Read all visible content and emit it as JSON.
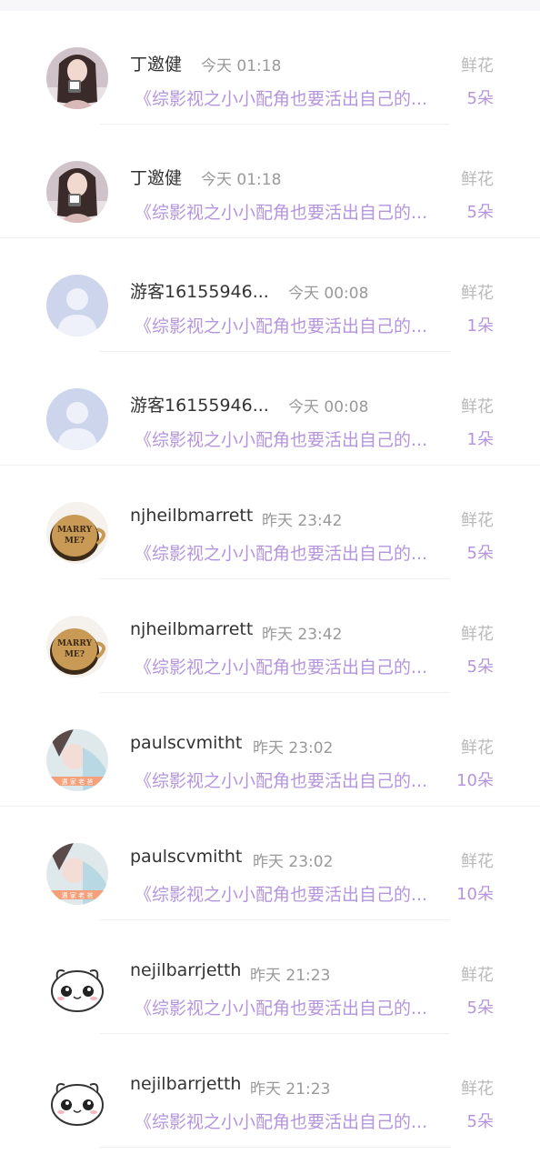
{
  "records": [
    {
      "name": "丁邀健",
      "time": "今天 01:18",
      "gift": "鲜花",
      "book": "《综影视之小小配角也要活出自己的...",
      "count": "5朵",
      "avatar": "girl-photo"
    },
    {
      "name": "丁邀健",
      "time": "今天 01:18",
      "gift": "鲜花",
      "book": "《综影视之小小配角也要活出自己的...",
      "count": "5朵",
      "avatar": "girl-photo"
    },
    {
      "name": "游客16155946...",
      "time": "今天 00:08",
      "gift": "鲜花",
      "book": "《综影视之小小配角也要活出自己的...",
      "count": "1朵",
      "avatar": "default-user"
    },
    {
      "name": "游客16155946...",
      "time": "今天 00:08",
      "gift": "鲜花",
      "book": "《综影视之小小配角也要活出自己的...",
      "count": "1朵",
      "avatar": "default-user"
    },
    {
      "name": "njheilbmarrett",
      "time": "昨天 23:42",
      "gift": "鲜花",
      "book": "《综影视之小小配角也要活出自己的...",
      "count": "5朵",
      "avatar": "marry-me-cup"
    },
    {
      "name": "njheilbmarrett",
      "time": "昨天 23:42",
      "gift": "鲜花",
      "book": "《综影视之小小配角也要活出自己的...",
      "count": "5朵",
      "avatar": "marry-me-cup"
    },
    {
      "name": "paulscvmitht",
      "time": "昨天 23:02",
      "gift": "鲜花",
      "book": "《综影视之小小配角也要活出自己的...",
      "count": "10朵",
      "avatar": "selfie-photo"
    },
    {
      "name": "paulscvmitht",
      "time": "昨天 23:02",
      "gift": "鲜花",
      "book": "《综影视之小小配角也要活出自己的...",
      "count": "10朵",
      "avatar": "selfie-photo"
    },
    {
      "name": "nejilbarrjetth",
      "time": "昨天 21:23",
      "gift": "鲜花",
      "book": "《综影视之小小配角也要活出自己的...",
      "count": "5朵",
      "avatar": "cartoon-bun"
    },
    {
      "name": "nejilbarrjetth",
      "time": "昨天 21:23",
      "gift": "鲜花",
      "book": "《综影视之小小配角也要活出自己的...",
      "count": "5朵",
      "avatar": "cartoon-bun"
    }
  ],
  "colors": {
    "accent": "#b495dd",
    "name": "#333333",
    "muted": "#999999",
    "divider": "#f0eef2"
  }
}
